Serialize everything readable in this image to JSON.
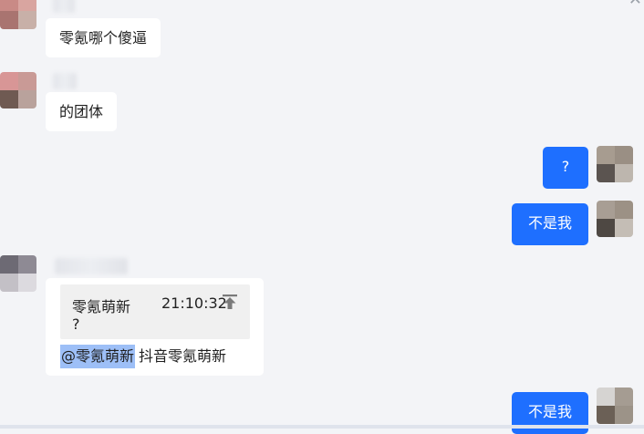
{
  "messages": [
    {
      "side": "left",
      "text": "零氪哪个傻逼"
    },
    {
      "side": "left",
      "text": "的团体"
    },
    {
      "side": "right",
      "text": "?"
    },
    {
      "side": "right",
      "text": "不是我"
    },
    {
      "side": "left",
      "quote": {
        "sender": "零氪萌新",
        "time": "21:10:32",
        "text": "?"
      },
      "mention": "@零氪萌新",
      "text": "抖音零氪萌新"
    },
    {
      "side": "right",
      "text": "不是我"
    }
  ],
  "icons": {
    "close": "close-icon",
    "quote_jump": "jump-to-quote-icon"
  },
  "colors": {
    "background": "#f3f4f7",
    "self_bubble": "#1e6fff",
    "other_bubble": "#ffffff",
    "mention_highlight": "#9dbff7"
  }
}
